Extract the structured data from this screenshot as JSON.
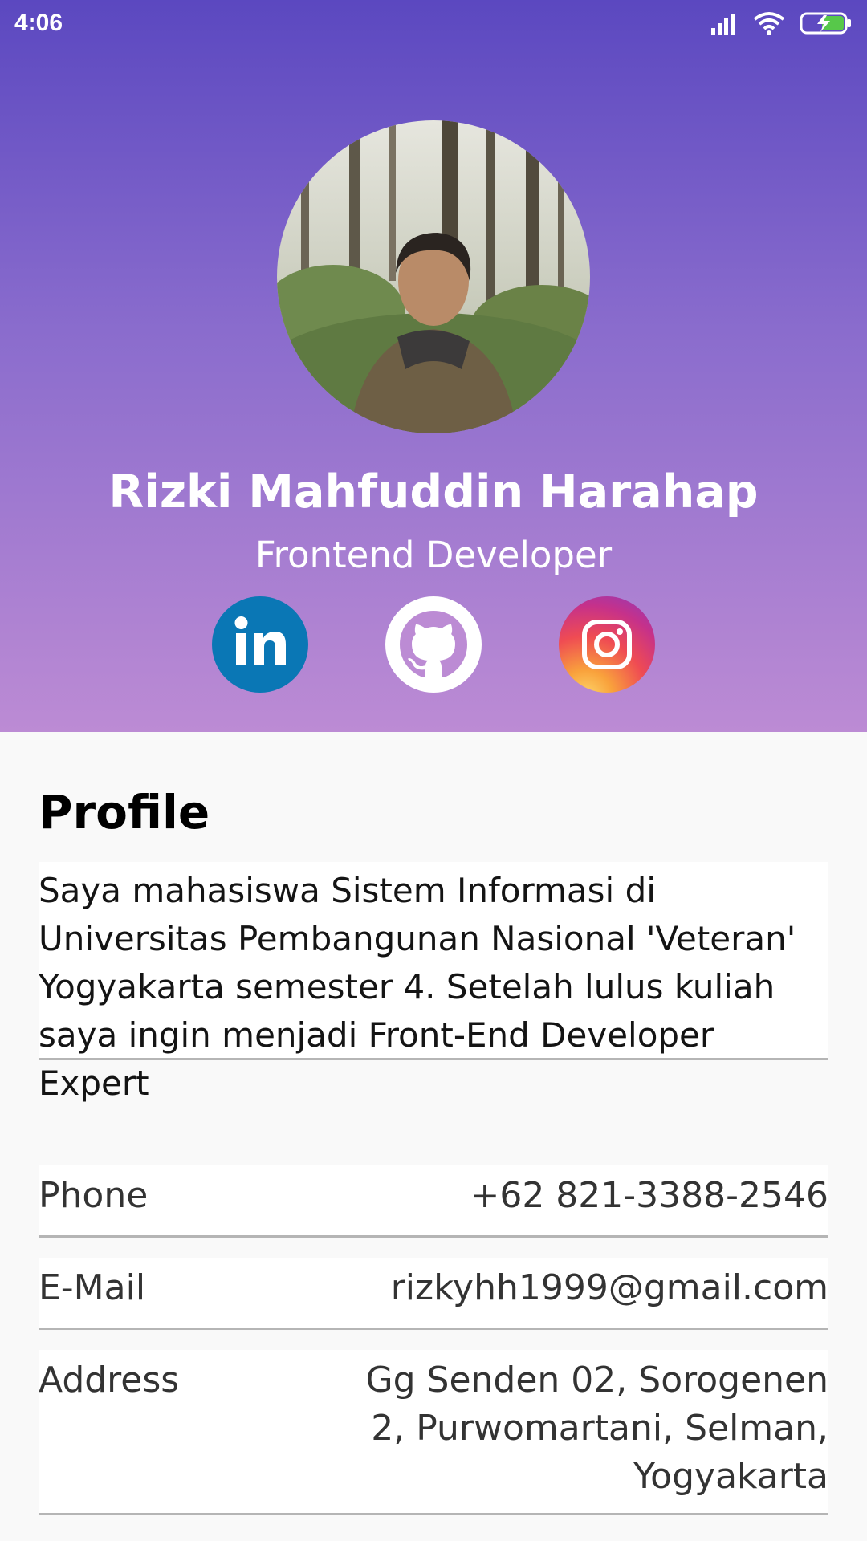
{
  "status_bar": {
    "time": "4:06",
    "icons": [
      "signal-icon",
      "wifi-icon",
      "battery-charging-icon"
    ]
  },
  "profile": {
    "name": "Rizki Mahfuddin Harahap",
    "role": "Frontend Developer",
    "avatar": "profile-photo"
  },
  "social": [
    {
      "name": "linkedin-icon",
      "color": "#0a77b5"
    },
    {
      "name": "github-icon",
      "color": "#ffffff"
    },
    {
      "name": "instagram-icon",
      "color": "#e1306c"
    }
  ],
  "section": {
    "title": "Profile",
    "bio": "Saya mahasiswa Sistem Informasi di Universitas Pembangunan Nasional 'Veteran' Yogyakarta semester 4. Setelah lulus kuliah saya ingin menjadi Front-End Developer Expert"
  },
  "details": {
    "phone": {
      "label": "Phone",
      "value": "+62 821-3388-2546"
    },
    "email": {
      "label": "E-Mail",
      "value": "rizkyhh1999@gmail.com"
    },
    "address": {
      "label": "Address",
      "value": "Gg Senden 02, Sorogenen 2, Purwomartani, Selman, Yogyakarta"
    }
  },
  "colors": {
    "header_top": "#5b48c0",
    "header_bottom": "#bc8bd4",
    "background": "#f9f9f9",
    "divider": "#b5b5b5"
  }
}
